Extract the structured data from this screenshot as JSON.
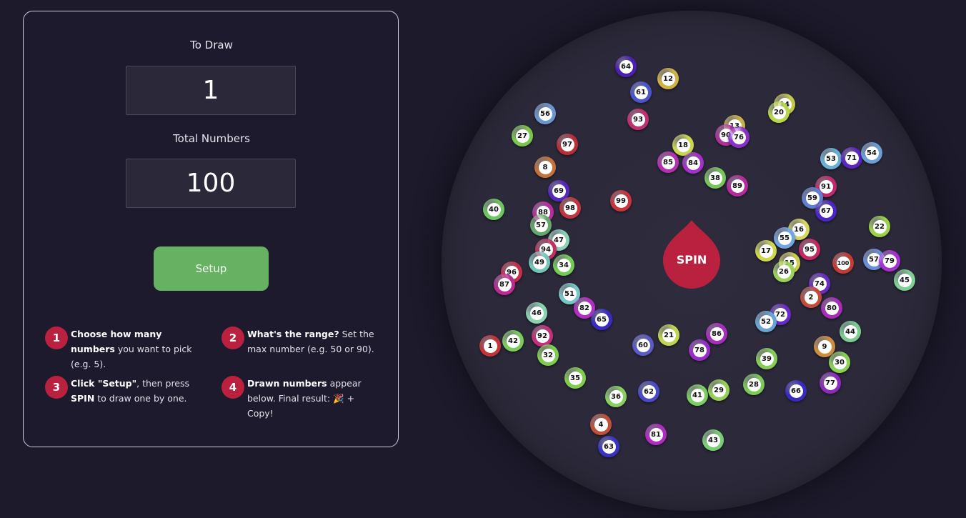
{
  "form": {
    "to_draw_label": "To Draw",
    "to_draw_value": "1",
    "total_label": "Total Numbers",
    "total_value": "100",
    "setup_label": "Setup"
  },
  "steps": [
    {
      "num": "1",
      "bold": "Choose how many numbers",
      "rest": " you want to pick (e.g. 5)."
    },
    {
      "num": "2",
      "bold": "What's the range?",
      "rest": " Set the max number (e.g. 50 or 90)."
    },
    {
      "num": "3",
      "bold": "Click \"Setup\"",
      "rest": ", then press ",
      "bold2": "SPIN",
      "rest2": " to draw one by one."
    },
    {
      "num": "4",
      "bold": "Drawn numbers",
      "rest": " appear below. Final result: 🎉 + Copy!"
    }
  ],
  "spin_label": "SPIN",
  "colors": {
    "accent_red": "#b9213f",
    "setup_green": "#66b262",
    "background": "#1c1a2b",
    "wheel": "#2b2939"
  },
  "balls": [
    {
      "n": "64",
      "c": "#4b1fb0"
    },
    {
      "n": "12",
      "c": "#d0b246"
    },
    {
      "n": "61",
      "c": "#4a55c9"
    },
    {
      "n": "56",
      "c": "#6b95cf"
    },
    {
      "n": "93",
      "c": "#c12f6f"
    },
    {
      "n": "14",
      "c": "#c4c84a"
    },
    {
      "n": "20",
      "c": "#b7d64b"
    },
    {
      "n": "13",
      "c": "#c8b34a"
    },
    {
      "n": "27",
      "c": "#7ac64c"
    },
    {
      "n": "97",
      "c": "#b82f3a"
    },
    {
      "n": "90",
      "c": "#b02f9a"
    },
    {
      "n": "76",
      "c": "#8a2fc8"
    },
    {
      "n": "18",
      "c": "#c9d64d"
    },
    {
      "n": "53",
      "c": "#6ab0d6"
    },
    {
      "n": "71",
      "c": "#5a25c0"
    },
    {
      "n": "54",
      "c": "#6a9ed6"
    },
    {
      "n": "8",
      "c": "#c4723a"
    },
    {
      "n": "85",
      "c": "#b52fb2"
    },
    {
      "n": "84",
      "c": "#a52fcb"
    },
    {
      "n": "38",
      "c": "#76c65a"
    },
    {
      "n": "69",
      "c": "#5626c0"
    },
    {
      "n": "89",
      "c": "#b42a9e"
    },
    {
      "n": "99",
      "c": "#c8343a"
    },
    {
      "n": "91",
      "c": "#c12a6a"
    },
    {
      "n": "59",
      "c": "#5f7fd0"
    },
    {
      "n": "40",
      "c": "#6ec660"
    },
    {
      "n": "88",
      "c": "#ba2aa0"
    },
    {
      "n": "98",
      "c": "#c03540"
    },
    {
      "n": "67",
      "c": "#4a25c8"
    },
    {
      "n": "22",
      "c": "#9cd04b"
    },
    {
      "n": "57",
      "c": "#63a86a"
    },
    {
      "n": "47",
      "c": "#8ad0b4"
    },
    {
      "n": "16",
      "c": "#d6d862"
    },
    {
      "n": "55",
      "c": "#72a6de"
    },
    {
      "n": "94",
      "c": "#c0305e"
    },
    {
      "n": "17",
      "c": "#d0d64e"
    },
    {
      "n": "95",
      "c": "#c42a60"
    },
    {
      "n": "49",
      "c": "#75c4b8"
    },
    {
      "n": "34",
      "c": "#72cc54"
    },
    {
      "n": "100",
      "c": "#c23b34"
    },
    {
      "n": "57",
      "c": "#6a8ed8"
    },
    {
      "n": "79",
      "c": "#a62fd4"
    },
    {
      "n": "96",
      "c": "#c4304c"
    },
    {
      "n": "15",
      "c": "#cccc50"
    },
    {
      "n": "26",
      "c": "#9cd25a"
    },
    {
      "n": "87",
      "c": "#ba2a92"
    },
    {
      "n": "45",
      "c": "#7ed094"
    },
    {
      "n": "74",
      "c": "#6a2bc4"
    },
    {
      "n": "51",
      "c": "#78c6c8"
    },
    {
      "n": "2",
      "c": "#c04c3a"
    },
    {
      "n": "82",
      "c": "#b22ec4"
    },
    {
      "n": "80",
      "c": "#a82cb8"
    },
    {
      "n": "46",
      "c": "#8ad2b0"
    },
    {
      "n": "65",
      "c": "#3a2ac4"
    },
    {
      "n": "72",
      "c": "#6a2ac8"
    },
    {
      "n": "52",
      "c": "#6aa4d4"
    },
    {
      "n": "44",
      "c": "#7acc90"
    },
    {
      "n": "92",
      "c": "#c22e7a"
    },
    {
      "n": "86",
      "c": "#a82cbe"
    },
    {
      "n": "21",
      "c": "#c0d650"
    },
    {
      "n": "1",
      "c": "#c23438"
    },
    {
      "n": "42",
      "c": "#7ccc5c"
    },
    {
      "n": "60",
      "c": "#5a5ac8"
    },
    {
      "n": "78",
      "c": "#982cc8"
    },
    {
      "n": "9",
      "c": "#cc8e40"
    },
    {
      "n": "32",
      "c": "#80cc50"
    },
    {
      "n": "39",
      "c": "#86cc56"
    },
    {
      "n": "30",
      "c": "#8ad054"
    },
    {
      "n": "35",
      "c": "#80cc4c"
    },
    {
      "n": "28",
      "c": "#7cc85a"
    },
    {
      "n": "77",
      "c": "#8c2ac0"
    },
    {
      "n": "36",
      "c": "#88d062"
    },
    {
      "n": "62",
      "c": "#4a4ac8"
    },
    {
      "n": "41",
      "c": "#7ace62"
    },
    {
      "n": "29",
      "c": "#94d056"
    },
    {
      "n": "66",
      "c": "#3a2ac4"
    },
    {
      "n": "4",
      "c": "#c0503a"
    },
    {
      "n": "81",
      "c": "#b02ac4"
    },
    {
      "n": "43",
      "c": "#7ccc76"
    },
    {
      "n": "63",
      "c": "#3a32c4"
    }
  ]
}
